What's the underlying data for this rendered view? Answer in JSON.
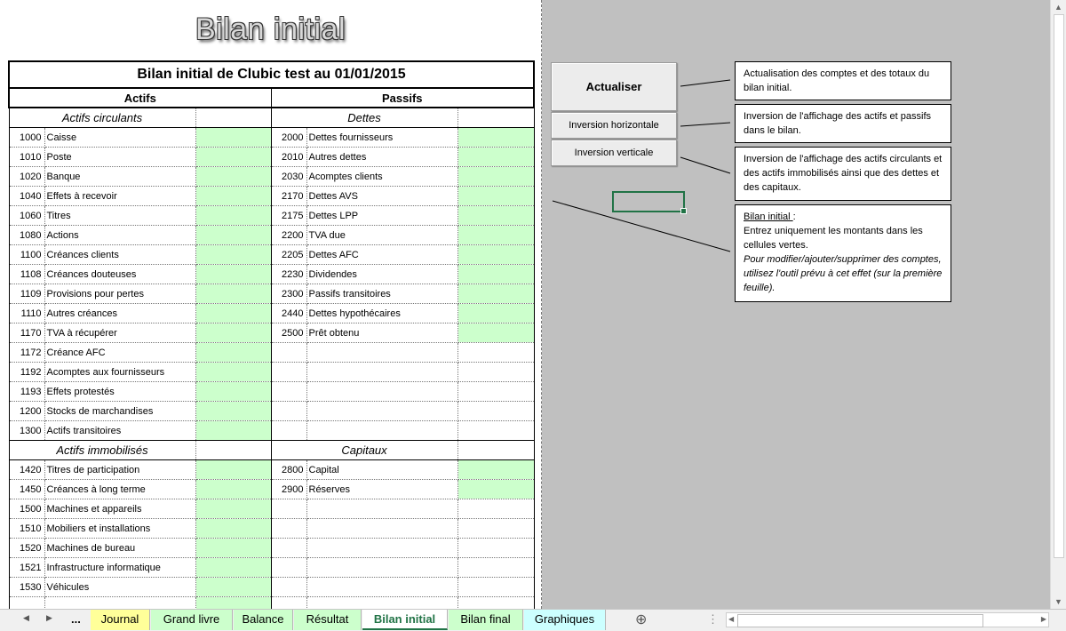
{
  "page_title": "Bilan initial",
  "balance": {
    "title": "Bilan initial de Clubic test au 01/01/2015",
    "actifs_header": "Actifs",
    "passifs_header": "Passifs",
    "actifs_circulants_label": "Actifs circulants",
    "dettes_label": "Dettes",
    "actifs_immobilises_label": "Actifs immobilisés",
    "capitaux_label": "Capitaux",
    "rows": [
      {
        "an": "1000",
        "al": "Caisse",
        "ag": true,
        "pn": "2000",
        "pl": "Dettes fournisseurs",
        "pg": true
      },
      {
        "an": "1010",
        "al": "Poste",
        "ag": true,
        "pn": "2010",
        "pl": "Autres dettes",
        "pg": true
      },
      {
        "an": "1020",
        "al": "Banque",
        "ag": true,
        "pn": "2030",
        "pl": "Acomptes clients",
        "pg": true
      },
      {
        "an": "1040",
        "al": "Effets à recevoir",
        "ag": true,
        "pn": "2170",
        "pl": "Dettes AVS",
        "pg": true
      },
      {
        "an": "1060",
        "al": "Titres",
        "ag": true,
        "pn": "2175",
        "pl": "Dettes LPP",
        "pg": true
      },
      {
        "an": "1080",
        "al": "Actions",
        "ag": true,
        "pn": "2200",
        "pl": "TVA due",
        "pg": true
      },
      {
        "an": "1100",
        "al": "Créances clients",
        "ag": true,
        "pn": "2205",
        "pl": "Dettes AFC",
        "pg": true
      },
      {
        "an": "1108",
        "al": "Créances douteuses",
        "ag": true,
        "pn": "2230",
        "pl": "Dividendes",
        "pg": true
      },
      {
        "an": "1109",
        "al": "Provisions pour pertes",
        "ag": true,
        "pn": "2300",
        "pl": "Passifs transitoires",
        "pg": true
      },
      {
        "an": "1110",
        "al": "Autres créances",
        "ag": true,
        "pn": "2440",
        "pl": "Dettes hypothécaires",
        "pg": true
      },
      {
        "an": "1170",
        "al": "TVA à récupérer",
        "ag": true,
        "pn": "2500",
        "pl": "Prêt obtenu",
        "pg": true
      },
      {
        "an": "1172",
        "al": "Créance AFC",
        "ag": true,
        "pn": "",
        "pl": "",
        "pg": false
      },
      {
        "an": "1192",
        "al": "Acomptes aux fournisseurs",
        "ag": true,
        "pn": "",
        "pl": "",
        "pg": false
      },
      {
        "an": "1193",
        "al": "Effets protestés",
        "ag": true,
        "pn": "",
        "pl": "",
        "pg": false
      },
      {
        "an": "1200",
        "al": "Stocks de marchandises",
        "ag": true,
        "pn": "",
        "pl": "",
        "pg": false
      },
      {
        "an": "1300",
        "al": "Actifs transitoires",
        "ag": true,
        "pn": "",
        "pl": "",
        "pg": false
      }
    ],
    "rows2": [
      {
        "an": "1420",
        "al": "Titres de participation",
        "ag": true,
        "pn": "2800",
        "pl": "Capital",
        "pg": true
      },
      {
        "an": "1450",
        "al": "Créances à long terme",
        "ag": true,
        "pn": "2900",
        "pl": "Réserves",
        "pg": true
      },
      {
        "an": "1500",
        "al": "Machines et appareils",
        "ag": true,
        "pn": "",
        "pl": "",
        "pg": false
      },
      {
        "an": "1510",
        "al": "Mobiliers et installations",
        "ag": true,
        "pn": "",
        "pl": "",
        "pg": false
      },
      {
        "an": "1520",
        "al": "Machines de bureau",
        "ag": true,
        "pn": "",
        "pl": "",
        "pg": false
      },
      {
        "an": "1521",
        "al": "Infrastructure informatique",
        "ag": true,
        "pn": "",
        "pl": "",
        "pg": false
      },
      {
        "an": "1530",
        "al": "Véhicules",
        "ag": true,
        "pn": "",
        "pl": "",
        "pg": false
      },
      {
        "an": "",
        "al": "",
        "ag": true,
        "pn": "",
        "pl": "",
        "pg": false
      }
    ]
  },
  "buttons": {
    "actualiser": "Actualiser",
    "inversion_horizontale": "Inversion horizontale",
    "inversion_verticale": "Inversion verticale"
  },
  "notes": {
    "actualiser": "Actualisation des comptes et des totaux du bilan initial.",
    "horizontale": "Inversion  de l'affichage des actifs et passifs  dans le bilan.",
    "verticale": "Inversion  de l'affichage des actifs circulants et des actifs immobilisés ainsi que des dettes et des capitaux.",
    "bilan_title": "Bilan initial ",
    "bilan_colon": ":",
    "bilan_line1": "Entrez uniquement les montants dans les cellules vertes.",
    "bilan_line2": "Pour modifier/ajouter/supprimer des comptes, utilisez l'outil  prévu à cet effet (sur la première feuille)."
  },
  "sheet_tabs": {
    "overflow": "...",
    "items": [
      "Journal",
      "Grand livre",
      "Balance",
      "Résultat",
      "Bilan initial",
      "Bilan final",
      "Graphiques"
    ],
    "active": "Bilan initial",
    "colors": [
      "#ffff99",
      "#ccffcc",
      "#ccffcc",
      "#ccffcc",
      "#ffffff",
      "#ccffcc",
      "#ccffff"
    ]
  },
  "icons": {
    "prev": "triangle-left-icon",
    "next": "triangle-right-icon",
    "add": "plus-circle-icon",
    "more": "vertical-dots-icon"
  },
  "colors": {
    "input_cell": "#ccffcc",
    "accent": "#217346",
    "background": "#c0c0c0"
  }
}
